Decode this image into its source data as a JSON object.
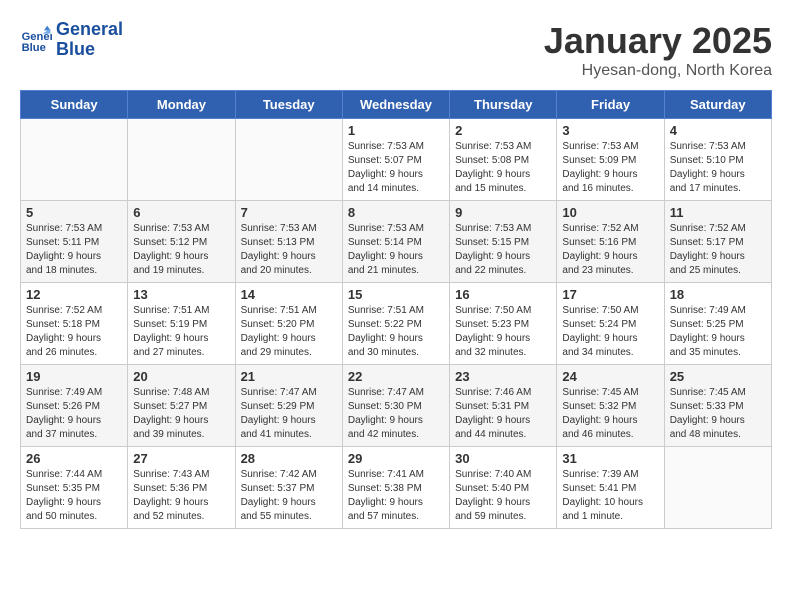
{
  "header": {
    "logo_line1": "General",
    "logo_line2": "Blue",
    "month": "January 2025",
    "location": "Hyesan-dong, North Korea"
  },
  "days_of_week": [
    "Sunday",
    "Monday",
    "Tuesday",
    "Wednesday",
    "Thursday",
    "Friday",
    "Saturday"
  ],
  "weeks": [
    [
      {
        "day": "",
        "content": ""
      },
      {
        "day": "",
        "content": ""
      },
      {
        "day": "",
        "content": ""
      },
      {
        "day": "1",
        "content": "Sunrise: 7:53 AM\nSunset: 5:07 PM\nDaylight: 9 hours\nand 14 minutes."
      },
      {
        "day": "2",
        "content": "Sunrise: 7:53 AM\nSunset: 5:08 PM\nDaylight: 9 hours\nand 15 minutes."
      },
      {
        "day": "3",
        "content": "Sunrise: 7:53 AM\nSunset: 5:09 PM\nDaylight: 9 hours\nand 16 minutes."
      },
      {
        "day": "4",
        "content": "Sunrise: 7:53 AM\nSunset: 5:10 PM\nDaylight: 9 hours\nand 17 minutes."
      }
    ],
    [
      {
        "day": "5",
        "content": "Sunrise: 7:53 AM\nSunset: 5:11 PM\nDaylight: 9 hours\nand 18 minutes."
      },
      {
        "day": "6",
        "content": "Sunrise: 7:53 AM\nSunset: 5:12 PM\nDaylight: 9 hours\nand 19 minutes."
      },
      {
        "day": "7",
        "content": "Sunrise: 7:53 AM\nSunset: 5:13 PM\nDaylight: 9 hours\nand 20 minutes."
      },
      {
        "day": "8",
        "content": "Sunrise: 7:53 AM\nSunset: 5:14 PM\nDaylight: 9 hours\nand 21 minutes."
      },
      {
        "day": "9",
        "content": "Sunrise: 7:53 AM\nSunset: 5:15 PM\nDaylight: 9 hours\nand 22 minutes."
      },
      {
        "day": "10",
        "content": "Sunrise: 7:52 AM\nSunset: 5:16 PM\nDaylight: 9 hours\nand 23 minutes."
      },
      {
        "day": "11",
        "content": "Sunrise: 7:52 AM\nSunset: 5:17 PM\nDaylight: 9 hours\nand 25 minutes."
      }
    ],
    [
      {
        "day": "12",
        "content": "Sunrise: 7:52 AM\nSunset: 5:18 PM\nDaylight: 9 hours\nand 26 minutes."
      },
      {
        "day": "13",
        "content": "Sunrise: 7:51 AM\nSunset: 5:19 PM\nDaylight: 9 hours\nand 27 minutes."
      },
      {
        "day": "14",
        "content": "Sunrise: 7:51 AM\nSunset: 5:20 PM\nDaylight: 9 hours\nand 29 minutes."
      },
      {
        "day": "15",
        "content": "Sunrise: 7:51 AM\nSunset: 5:22 PM\nDaylight: 9 hours\nand 30 minutes."
      },
      {
        "day": "16",
        "content": "Sunrise: 7:50 AM\nSunset: 5:23 PM\nDaylight: 9 hours\nand 32 minutes."
      },
      {
        "day": "17",
        "content": "Sunrise: 7:50 AM\nSunset: 5:24 PM\nDaylight: 9 hours\nand 34 minutes."
      },
      {
        "day": "18",
        "content": "Sunrise: 7:49 AM\nSunset: 5:25 PM\nDaylight: 9 hours\nand 35 minutes."
      }
    ],
    [
      {
        "day": "19",
        "content": "Sunrise: 7:49 AM\nSunset: 5:26 PM\nDaylight: 9 hours\nand 37 minutes."
      },
      {
        "day": "20",
        "content": "Sunrise: 7:48 AM\nSunset: 5:27 PM\nDaylight: 9 hours\nand 39 minutes."
      },
      {
        "day": "21",
        "content": "Sunrise: 7:47 AM\nSunset: 5:29 PM\nDaylight: 9 hours\nand 41 minutes."
      },
      {
        "day": "22",
        "content": "Sunrise: 7:47 AM\nSunset: 5:30 PM\nDaylight: 9 hours\nand 42 minutes."
      },
      {
        "day": "23",
        "content": "Sunrise: 7:46 AM\nSunset: 5:31 PM\nDaylight: 9 hours\nand 44 minutes."
      },
      {
        "day": "24",
        "content": "Sunrise: 7:45 AM\nSunset: 5:32 PM\nDaylight: 9 hours\nand 46 minutes."
      },
      {
        "day": "25",
        "content": "Sunrise: 7:45 AM\nSunset: 5:33 PM\nDaylight: 9 hours\nand 48 minutes."
      }
    ],
    [
      {
        "day": "26",
        "content": "Sunrise: 7:44 AM\nSunset: 5:35 PM\nDaylight: 9 hours\nand 50 minutes."
      },
      {
        "day": "27",
        "content": "Sunrise: 7:43 AM\nSunset: 5:36 PM\nDaylight: 9 hours\nand 52 minutes."
      },
      {
        "day": "28",
        "content": "Sunrise: 7:42 AM\nSunset: 5:37 PM\nDaylight: 9 hours\nand 55 minutes."
      },
      {
        "day": "29",
        "content": "Sunrise: 7:41 AM\nSunset: 5:38 PM\nDaylight: 9 hours\nand 57 minutes."
      },
      {
        "day": "30",
        "content": "Sunrise: 7:40 AM\nSunset: 5:40 PM\nDaylight: 9 hours\nand 59 minutes."
      },
      {
        "day": "31",
        "content": "Sunrise: 7:39 AM\nSunset: 5:41 PM\nDaylight: 10 hours\nand 1 minute."
      },
      {
        "day": "",
        "content": ""
      }
    ]
  ]
}
